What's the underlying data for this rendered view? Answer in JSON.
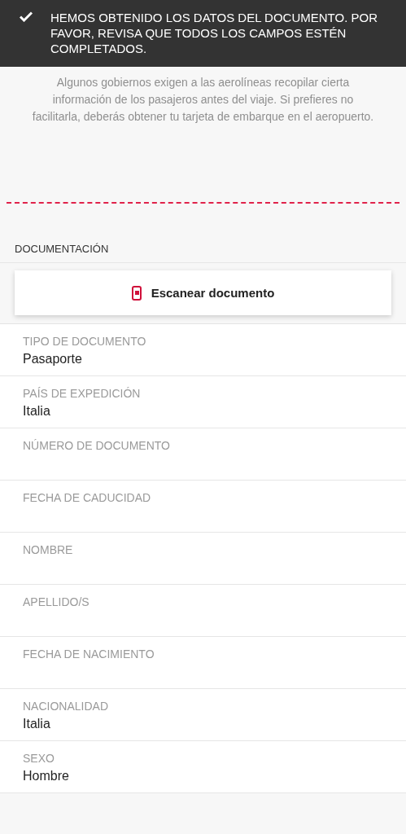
{
  "banner": {
    "message": "HEMOS OBTENIDO LOS DATOS DEL DOCUMENTO. POR FAVOR, REVISA QUE TODOS LOS CAMPOS ESTÉN COMPLETADOS."
  },
  "notice": "Algunos gobiernos exigen a las aerolíneas recopilar cierta información de los pasajeros antes del viaje. Si prefieres no facilitarla, deberás obtener tu tarjeta de embarque en el aeropuerto.",
  "section": {
    "title": "DOCUMENTACIÓN"
  },
  "scan_button": {
    "label": "Escanear documento"
  },
  "fields": [
    {
      "label": "TIPO DE DOCUMENTO",
      "value": "Pasaporte"
    },
    {
      "label": "PAÍS DE EXPEDICIÓN",
      "value": "Italia"
    },
    {
      "label": "NÚMERO DE DOCUMENTO"
    },
    {
      "label": "FECHA DE CADUCIDAD"
    },
    {
      "label": "NOMBRE"
    },
    {
      "label": "APELLIDO/S"
    },
    {
      "label": "FECHA DE NACIMIENTO"
    },
    {
      "label": "NACIONALIDAD",
      "value": "Italia"
    },
    {
      "label": "SEXO",
      "value": "Hombre"
    }
  ]
}
